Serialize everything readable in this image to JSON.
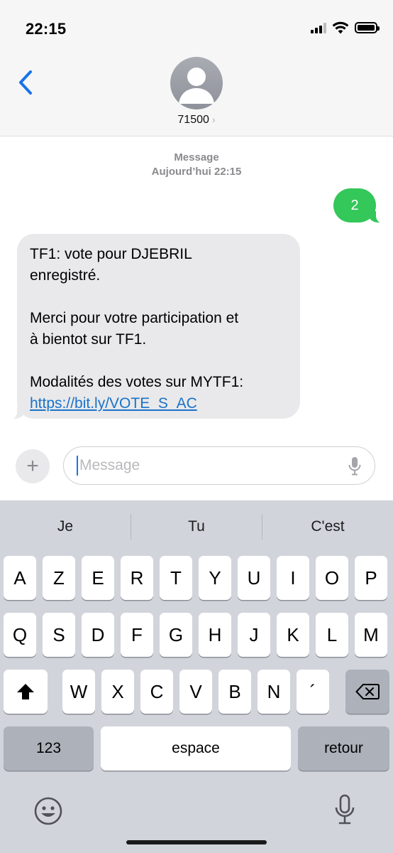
{
  "status": {
    "time": "22:15"
  },
  "header": {
    "contact_name": "71500",
    "contact_chevron": "›"
  },
  "conversation": {
    "service": "Message",
    "timestamp": "Aujourd’hui 22:15",
    "outgoing": "2",
    "incoming": {
      "line1": "TF1: vote pour DJEBRIL",
      "line2": "enregistré.",
      "line3": "Merci pour votre participation et",
      "line4": "à bientot sur TF1.",
      "line5": "Modalités des votes sur MYTF1:",
      "link": "https://bit.ly/VOTE_S_AC"
    }
  },
  "input": {
    "placeholder": "Message",
    "plus": "+"
  },
  "keyboard": {
    "suggestions": [
      "Je",
      "Tu",
      "C'est"
    ],
    "row1": [
      "A",
      "Z",
      "E",
      "R",
      "T",
      "Y",
      "U",
      "I",
      "O",
      "P"
    ],
    "row2": [
      "Q",
      "S",
      "D",
      "F",
      "G",
      "H",
      "J",
      "K",
      "L",
      "M"
    ],
    "row3": [
      "W",
      "X",
      "C",
      "V",
      "B",
      "N",
      "´"
    ],
    "numbers_key": "123",
    "space_key": "espace",
    "return_key": "retour"
  },
  "icons": {
    "back": "chevron-left-icon",
    "mic": "microphone-icon",
    "shift": "shift-icon",
    "delete": "backspace-icon",
    "emoji": "emoji-icon",
    "dictation": "dictation-icon"
  },
  "colors": {
    "accent": "#1a73e8",
    "outgoing_bubble": "#34c759",
    "incoming_bubble": "#e9e9eb",
    "keyboard_bg": "#d1d4db"
  }
}
